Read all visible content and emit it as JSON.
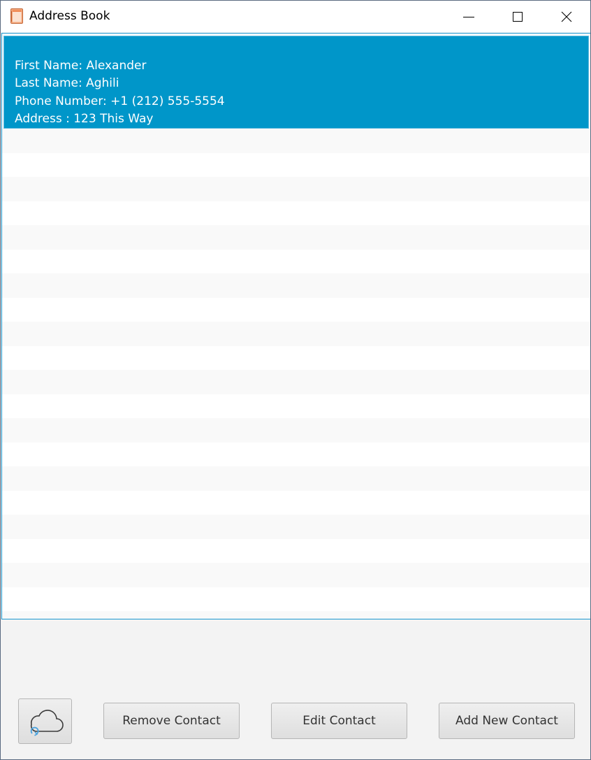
{
  "window": {
    "title": "Address Book",
    "app_icon": "address-book-icon",
    "controls": [
      "minimize-icon",
      "maximize-icon",
      "close-icon"
    ]
  },
  "contacts": [
    {
      "first_name_line": "First Name: Alexander",
      "last_name_line": "Last Name: Aghili",
      "phone_line": "Phone Number: +1 (212) 555-5554",
      "address_line": "Address : 123 This Way",
      "selected": true
    }
  ],
  "toolbar": {
    "sync_icon": "cloud-sync-icon",
    "remove_label": "Remove Contact",
    "edit_label": "Edit Contact",
    "add_label": "Add New Contact"
  },
  "colors": {
    "selection": "#0096c9",
    "selection_text": "#ffffff",
    "list_border": "#1a98d0",
    "stripe": "#f9f9f9"
  }
}
